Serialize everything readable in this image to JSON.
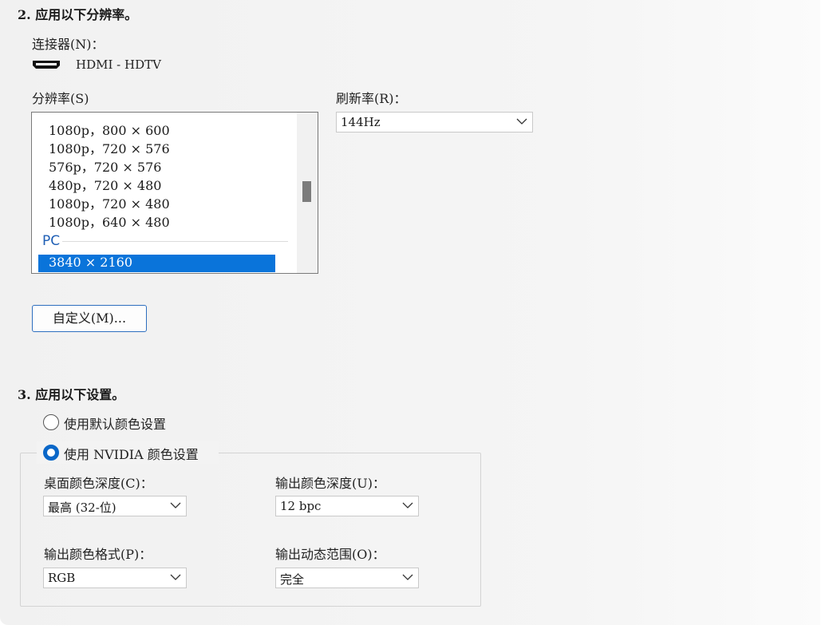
{
  "section2": {
    "title": "2.  应用以下分辨率。",
    "connector_label": "连接器(N)：",
    "connector_icon": "hdmi-connector-icon",
    "connector_value": "HDMI - HDTV",
    "resolution_label": "分辨率(S)",
    "resolutions": [
      "1080p，800 × 600",
      "1080p，720 × 576",
      "576p，720 × 576",
      "480p，720 × 480",
      "1080p，720 × 480",
      "1080p，640 × 480"
    ],
    "pc_group_label": "PC",
    "selected_resolution": "3840 × 2160",
    "refresh_label": "刷新率(R)：",
    "refresh_value": "144Hz",
    "customize_button": "自定义(M)..."
  },
  "section3": {
    "title": "3.  应用以下设置。",
    "radio_default_label": "使用默认颜色设置",
    "radio_default_selected": false,
    "radio_nvidia_label": "使用 NVIDIA 颜色设置",
    "radio_nvidia_selected": true,
    "desktop_depth_label": "桌面颜色深度(C)：",
    "desktop_depth_value": "最高 (32-位)",
    "output_depth_label": "输出颜色深度(U)：",
    "output_depth_value": "12 bpc",
    "output_format_label": "输出颜色格式(P)：",
    "output_format_value": "RGB",
    "output_range_label": "输出动态范围(O)：",
    "output_range_value": "完全"
  },
  "colors": {
    "accent": "#0a74da",
    "group_label": "#1f5fb5",
    "button_border": "#2e6fbf"
  }
}
